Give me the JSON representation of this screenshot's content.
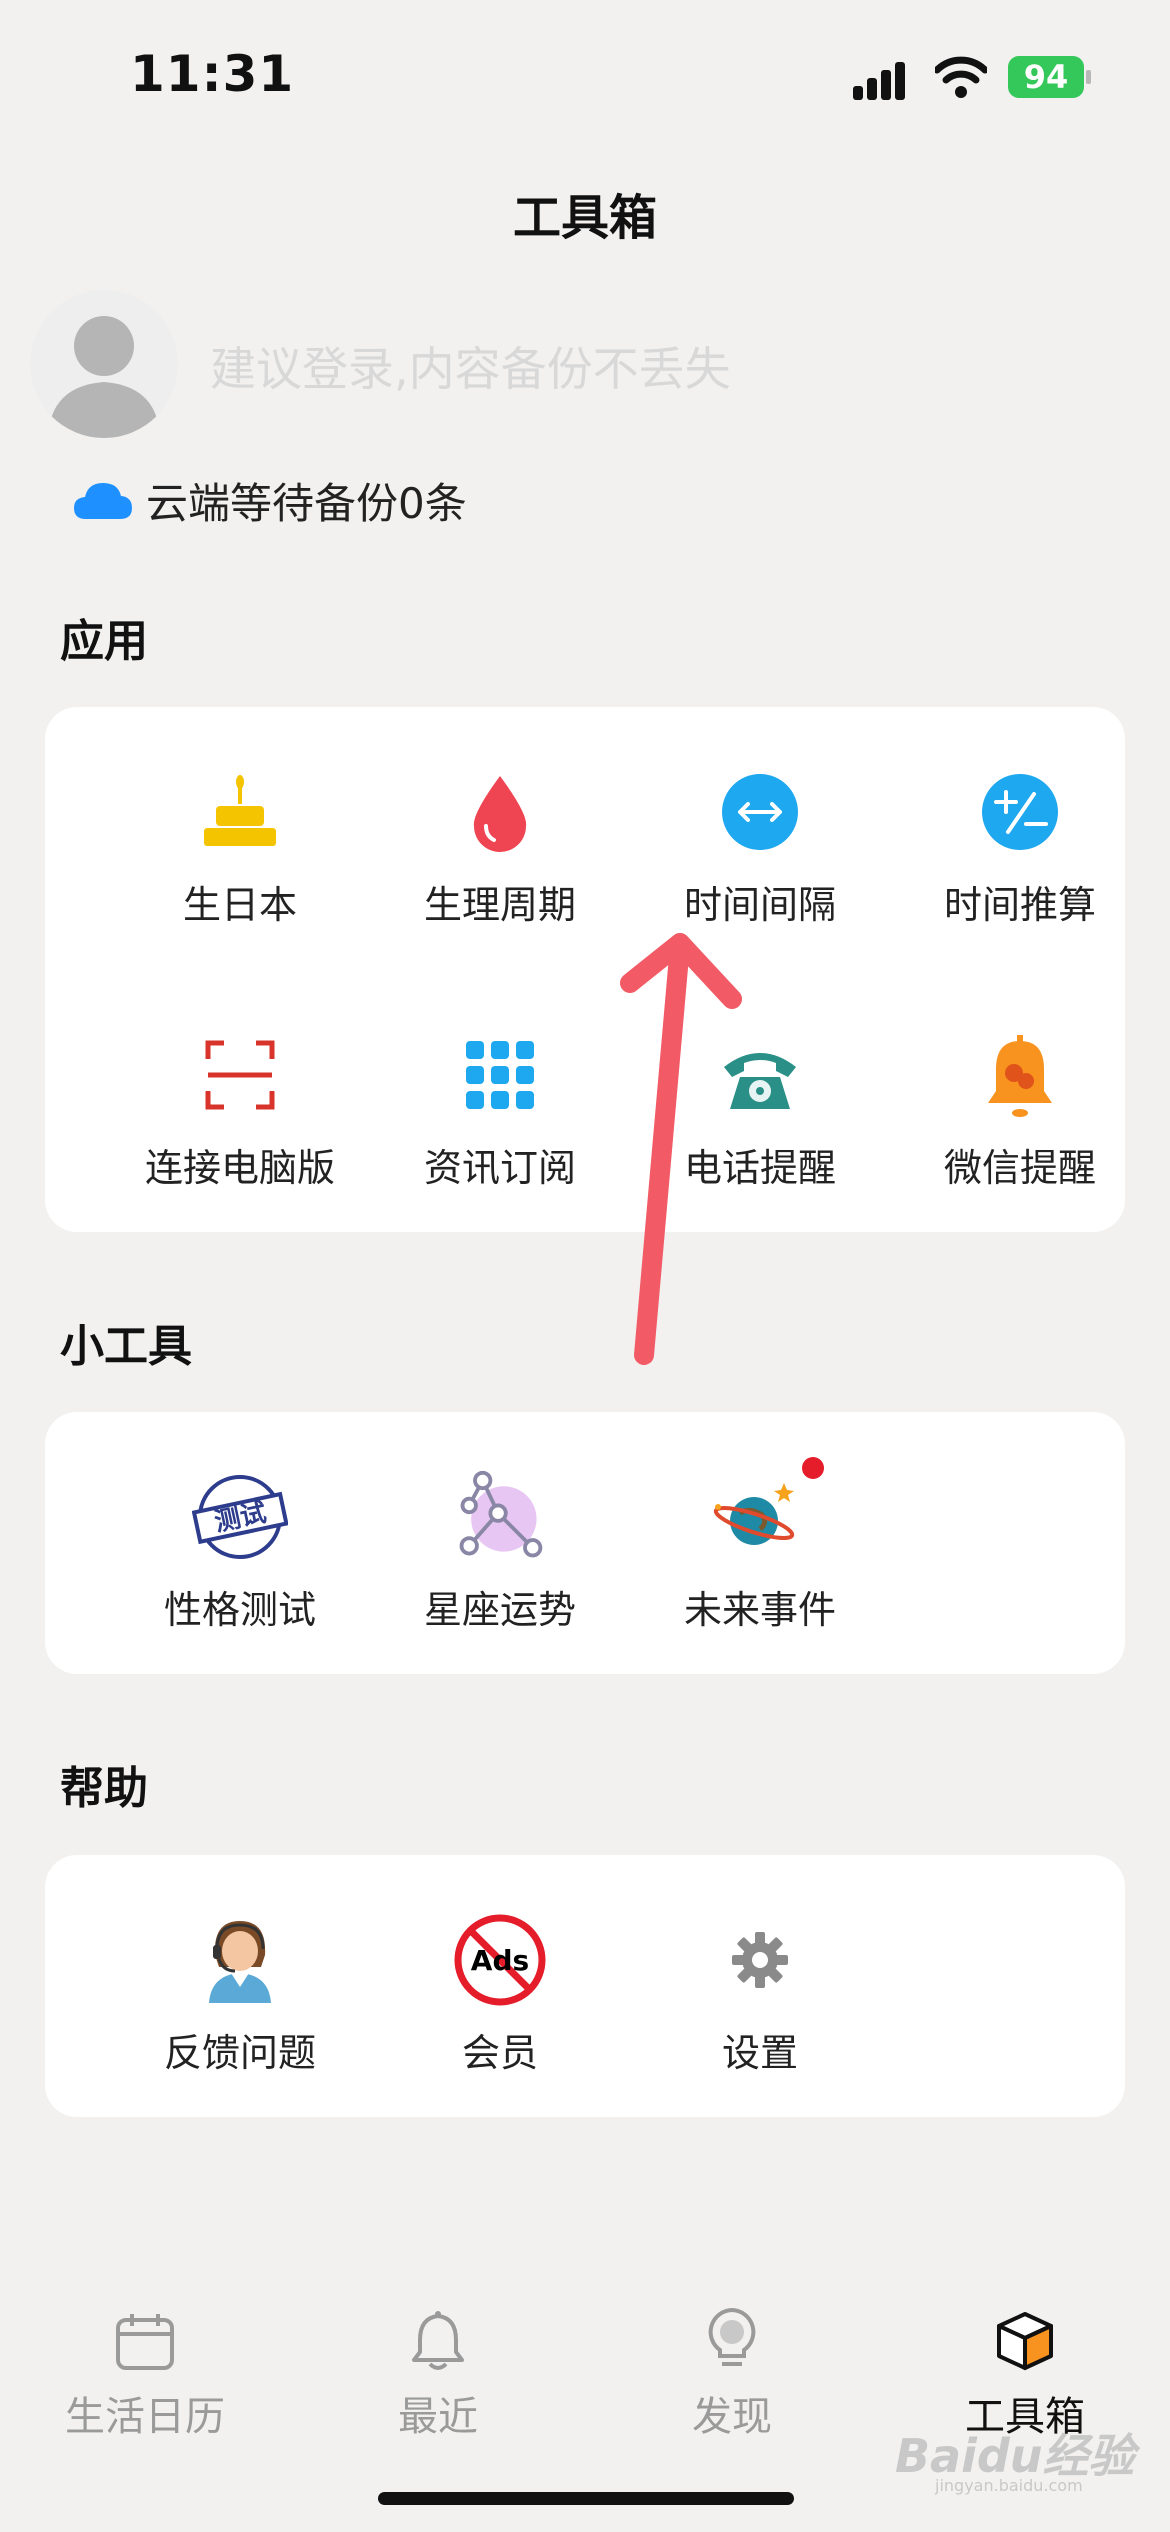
{
  "status_bar": {
    "time": "11:31",
    "battery": "94"
  },
  "header": {
    "title": "工具箱"
  },
  "profile": {
    "login_hint": "建议登录,内容备份不丢失",
    "cloud_status": "云端等待备份0条"
  },
  "sections": {
    "apps": {
      "title": "应用",
      "items": [
        {
          "label": "生日本",
          "icon": "birthday-cake-icon"
        },
        {
          "label": "生理周期",
          "icon": "blood-drop-icon"
        },
        {
          "label": "时间间隔",
          "icon": "double-arrow-icon"
        },
        {
          "label": "时间推算",
          "icon": "plus-minus-icon"
        },
        {
          "label": "连接电脑版",
          "icon": "scan-frame-icon"
        },
        {
          "label": "资讯订阅",
          "icon": "grid-icon"
        },
        {
          "label": "电话提醒",
          "icon": "telephone-icon"
        },
        {
          "label": "微信提醒",
          "icon": "bell-wechat-icon"
        }
      ]
    },
    "tools": {
      "title": "小工具",
      "items": [
        {
          "label": "性格测试",
          "icon": "test-stamp-icon",
          "stamp_text": "测试"
        },
        {
          "label": "星座运势",
          "icon": "constellation-icon"
        },
        {
          "label": "未来事件",
          "icon": "planet-icon"
        }
      ]
    },
    "help": {
      "title": "帮助",
      "items": [
        {
          "label": "反馈问题",
          "icon": "customer-service-icon"
        },
        {
          "label": "会员",
          "icon": "no-ads-icon",
          "ads_text": "Ads"
        },
        {
          "label": "设置",
          "icon": "gear-icon"
        }
      ]
    }
  },
  "tab_bar": [
    {
      "label": "生活日历",
      "icon": "calendar-icon",
      "active": false
    },
    {
      "label": "最近",
      "icon": "bell-icon",
      "active": false
    },
    {
      "label": "发现",
      "icon": "lightbulb-icon",
      "active": false
    },
    {
      "label": "工具箱",
      "icon": "cube-icon",
      "active": true
    }
  ],
  "watermark": {
    "text": "Baidu经验",
    "sub": "jingyan.baidu.com"
  },
  "colors": {
    "accent_blue": "#1ea8f0",
    "annotation_red": "#f25b66",
    "active_orange": "#f7931e"
  }
}
